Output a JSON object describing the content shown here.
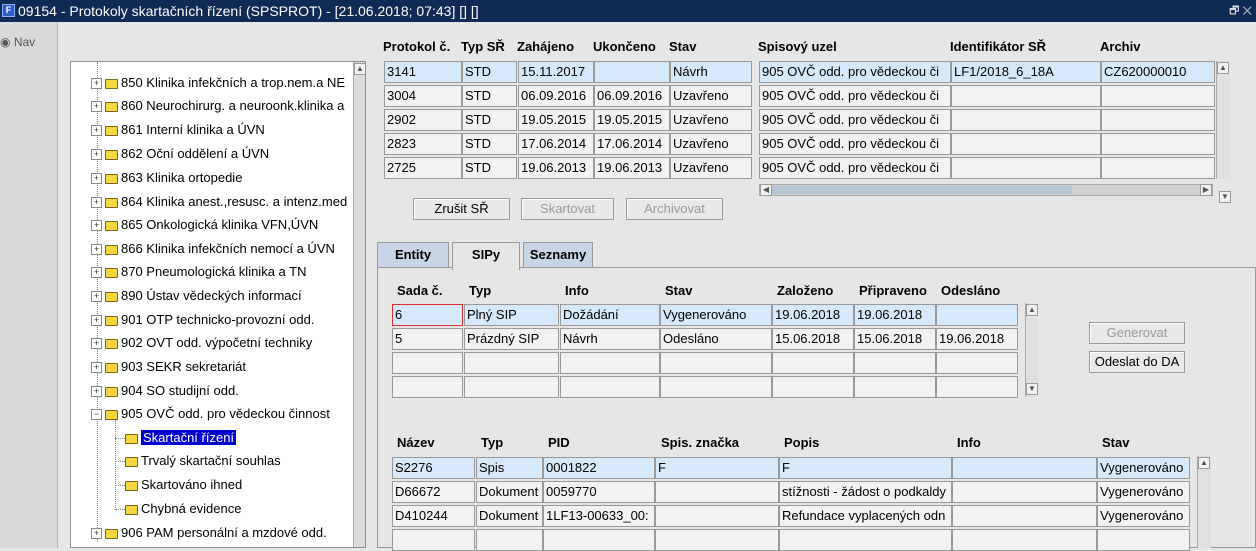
{
  "window": {
    "title": "09154 - Protokoly skartačních řízení (SPSPROT) - [21.06.2018; 07:43]  [] []",
    "controls": "🗗 ✕"
  },
  "nav": {
    "label": "Nav"
  },
  "tree": {
    "items": [
      {
        "label": "850 Klinika infekčních a trop.nem.a NE"
      },
      {
        "label": "860 Neurochirurg. a neuroonk.klinika a"
      },
      {
        "label": "861 Interní klinika a ÚVN"
      },
      {
        "label": "862 Oční oddělení a ÚVN"
      },
      {
        "label": "863 Klinika ortopedie"
      },
      {
        "label": "864 Klinika anest.,resusc. a intenz.med"
      },
      {
        "label": "865 Onkologická klinika VFN,ÚVN"
      },
      {
        "label": "866 Klinika infekčních nemocí a ÚVN"
      },
      {
        "label": "870 Pneumologická klinika a TN"
      },
      {
        "label": "890 Ústav vědeckých informací"
      },
      {
        "label": "901 OTP technicko-provozní odd."
      },
      {
        "label": "902 OVT odd. výpočetní techniky"
      },
      {
        "label": "903 SEKR sekretariát"
      },
      {
        "label": "904 SO studijní odd."
      },
      {
        "label": "905 OVČ odd. pro vědeckou činnost"
      }
    ],
    "children": [
      {
        "label": "Skartační řízení"
      },
      {
        "label": "Trvalý skartační souhlas"
      },
      {
        "label": "Skartováno ihned"
      },
      {
        "label": "Chybná evidence"
      }
    ],
    "last": {
      "label": "906 PAM personální a mzdové odd."
    }
  },
  "protocols": {
    "headers": [
      "Protokol č.",
      "Typ SŘ",
      "Zahájeno",
      "Ukončeno",
      "Stav",
      "Spisový uzel",
      "Identifikátor SŘ",
      "Archiv"
    ],
    "rows": [
      [
        "3141",
        "STD",
        "15.11.2017",
        "",
        "Návrh",
        "905 OVČ odd. pro vědeckou či",
        "LF1/2018_6_18A",
        "CZ620000010"
      ],
      [
        "3004",
        "STD",
        "06.09.2016",
        "06.09.2016",
        "Uzavřeno",
        "905 OVČ odd. pro vědeckou či",
        "",
        ""
      ],
      [
        "2902",
        "STD",
        "19.05.2015",
        "19.05.2015",
        "Uzavřeno",
        "905 OVČ odd. pro vědeckou či",
        "",
        ""
      ],
      [
        "2823",
        "STD",
        "17.06.2014",
        "17.06.2014",
        "Uzavřeno",
        "905 OVČ odd. pro vědeckou či",
        "",
        ""
      ],
      [
        "2725",
        "STD",
        "19.06.2013",
        "19.06.2013",
        "Uzavřeno",
        "905 OVČ odd. pro vědeckou či",
        "",
        ""
      ]
    ]
  },
  "actions": {
    "cancel": "Zrušit SŘ",
    "shred": "Skartovat",
    "archive": "Archivovat"
  },
  "tabs": {
    "entity": "Entity",
    "sip": "SIPy",
    "lists": "Seznamy"
  },
  "sips": {
    "headers": [
      "Sada č.",
      "Typ",
      "Info",
      "Stav",
      "Založeno",
      "Připraveno",
      "Odesláno"
    ],
    "rows": [
      [
        "6",
        "Plný SIP",
        "Dožádání",
        "Vygenerováno",
        "19.06.2018",
        "19.06.2018",
        ""
      ],
      [
        "5",
        "Prázdný SIP",
        "Návrh",
        "Odesláno",
        "15.06.2018",
        "15.06.2018",
        "19.06.2018"
      ],
      [
        "",
        "",
        "",
        "",
        "",
        "",
        ""
      ],
      [
        "",
        "",
        "",
        "",
        "",
        "",
        ""
      ]
    ]
  },
  "sip_actions": {
    "generate": "Generovat",
    "send": "Odeslat do DA"
  },
  "items": {
    "headers": [
      "Název",
      "Typ",
      "PID",
      "Spis. značka",
      "Popis",
      "Info",
      "Stav"
    ],
    "rows": [
      [
        "S2276",
        "Spis",
        "0001822",
        "F",
        "F",
        "",
        "Vygenerováno"
      ],
      [
        "D66672",
        "Dokument",
        "0059770",
        "",
        "stížnosti - žádost o podkaldy",
        "",
        "Vygenerováno"
      ],
      [
        "D410244",
        "Dokument",
        "1LF13-00633_00:",
        "",
        "Refundace vyplacených odn",
        "",
        "Vygenerováno"
      ],
      [
        "",
        "",
        "",
        "",
        "",
        "",
        ""
      ]
    ]
  }
}
